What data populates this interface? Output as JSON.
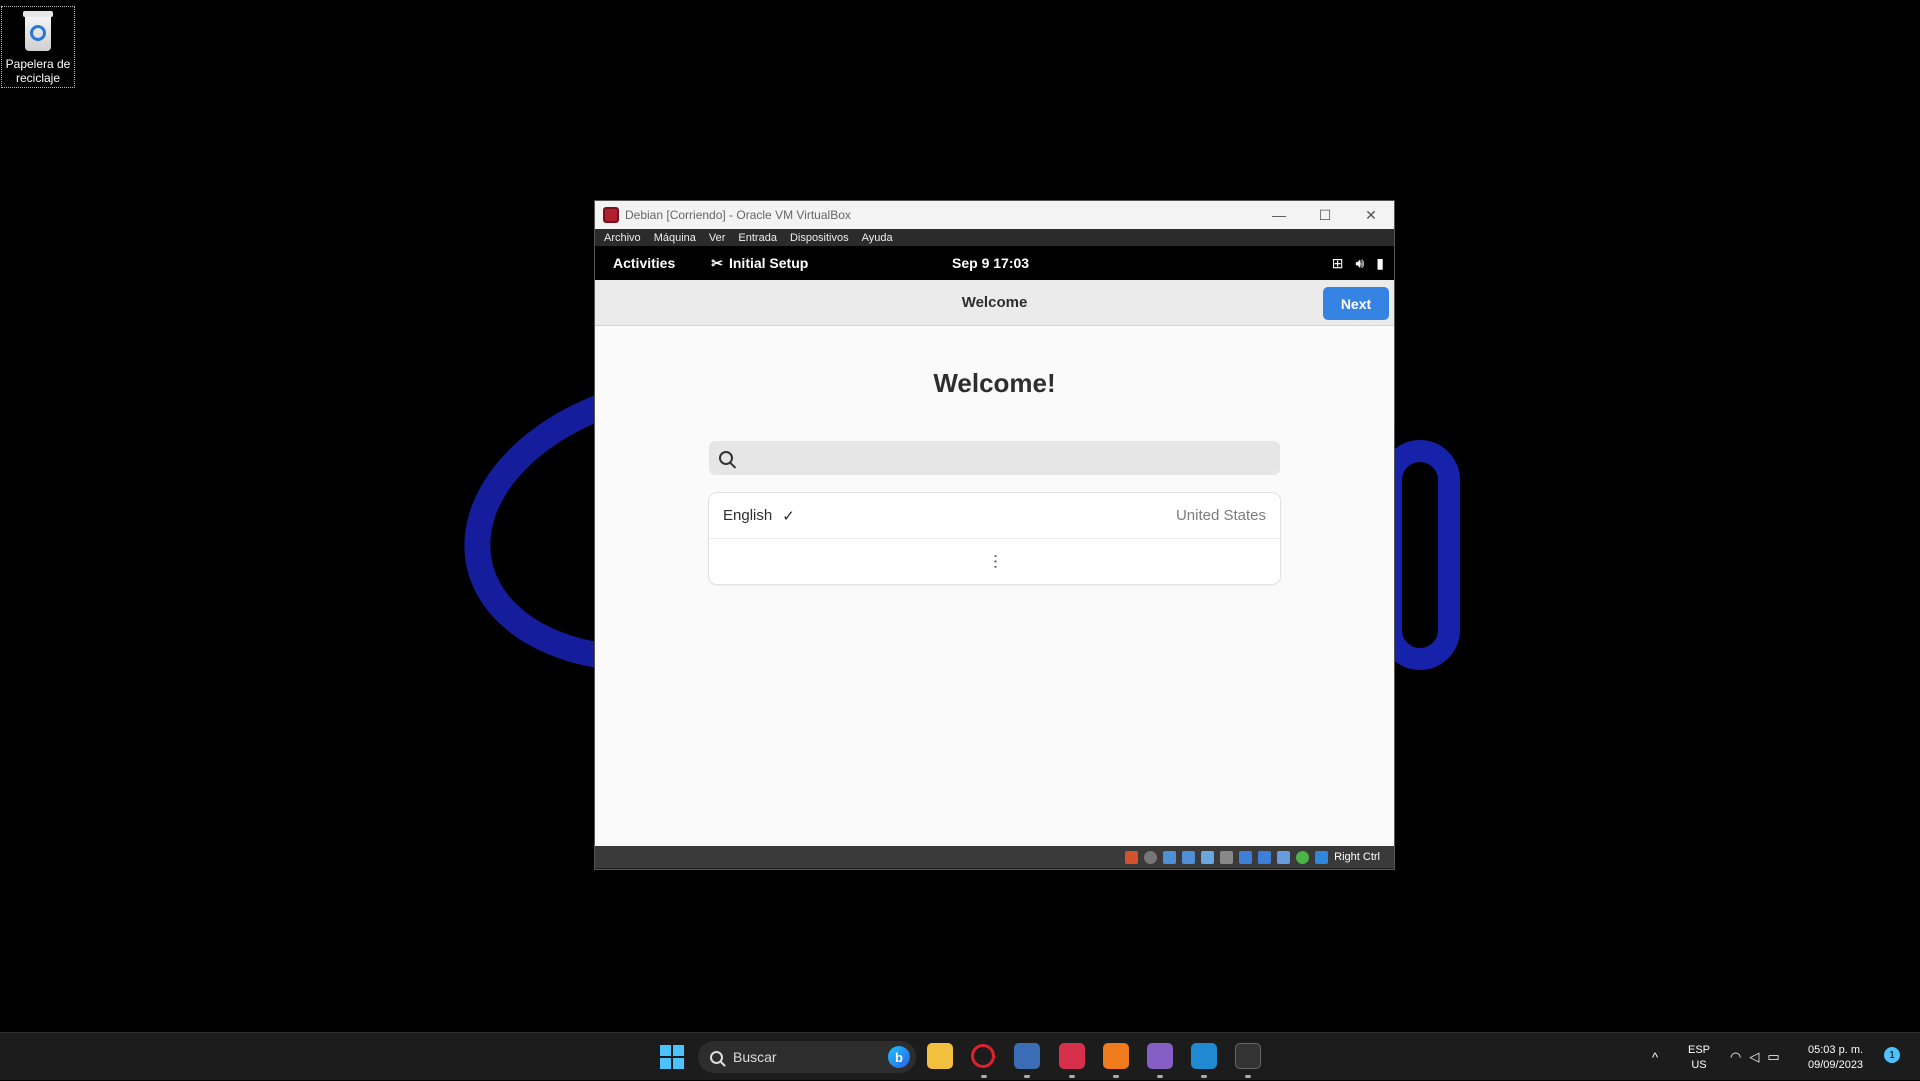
{
  "desktop": {
    "recycle_bin_label": "Papelera de reciclaje"
  },
  "vbox": {
    "title": "Debian [Corriendo] - Oracle VM VirtualBox",
    "minimize": "—",
    "maximize": "☐",
    "close": "✕",
    "menu": [
      "Archivo",
      "Máquina",
      "Ver",
      "Entrada",
      "Dispositivos",
      "Ayuda"
    ],
    "host_key": "Right Ctrl"
  },
  "gnome": {
    "activities": "Activities",
    "app_name": "Initial Setup",
    "clock": "Sep 9  17:03"
  },
  "setup": {
    "header_title": "Welcome",
    "next_label": "Next",
    "heading": "Welcome!",
    "search_placeholder": "",
    "languages": [
      {
        "name": "English",
        "check": "✓",
        "region": "United States"
      }
    ],
    "more": "⋯"
  },
  "taskbar": {
    "search_label": "Buscar",
    "bing": "b",
    "overflow": "^",
    "lang_top": "ESP",
    "lang_bottom": "US",
    "time": "05:03 p. m.",
    "date": "09/09/2023",
    "notifications": "1",
    "apps": [
      "file-explorer",
      "opera",
      "virtualbox",
      "debian",
      "xampp",
      "visual-studio",
      "vscode",
      "terminal"
    ]
  },
  "colors": {
    "accent": "#3584e4",
    "windows_accent": "#4cc2ff"
  }
}
